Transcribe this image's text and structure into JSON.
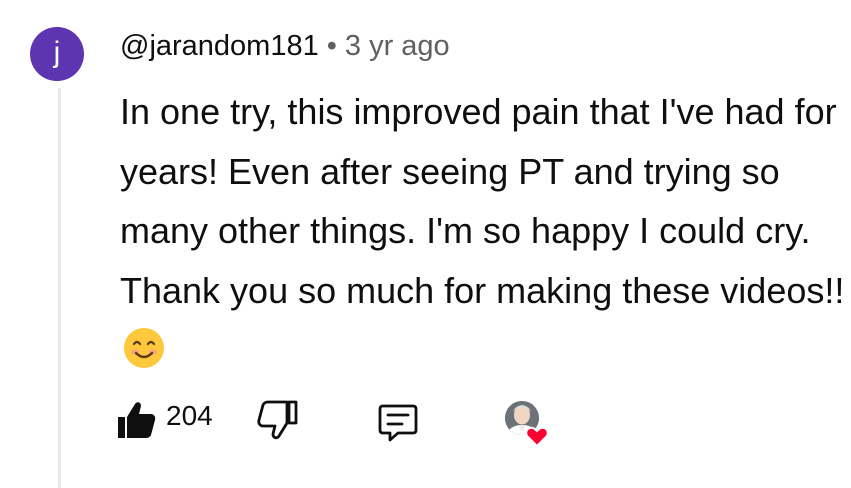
{
  "comment": {
    "avatar_letter": "j",
    "avatar_color": "#5e35b1",
    "handle": "@jarandom181",
    "separator": "•",
    "age": "3 yr ago",
    "text": "In one try, this improved pain that I've had for years! Even after seeing PT and trying so many other things. I'm so happy I could cry. Thank you so much for making these videos!!",
    "emoji": "smiling-face-icon"
  },
  "actions": {
    "like_count": "204",
    "like_icon": "thumbs-up-filled-icon",
    "dislike_icon": "thumbs-down-icon",
    "reply_icon": "reply-comment-icon",
    "creator_heart_icon": "creator-heart-badge-icon",
    "heart_color": "#ff0033"
  }
}
